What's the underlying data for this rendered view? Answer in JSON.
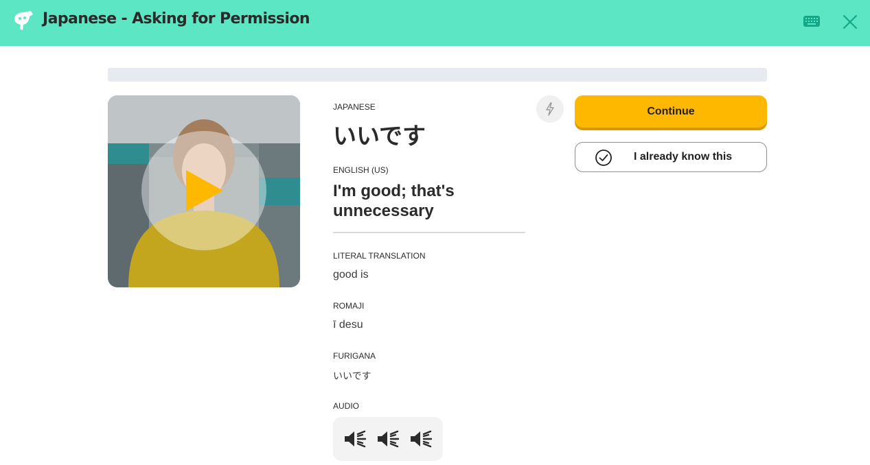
{
  "header": {
    "title": "Japanese - Asking for Permission",
    "logo_icon": "mascot-logo-icon",
    "keyboard_icon": "keyboard-icon",
    "close_icon": "close-icon",
    "background_color": "#5ce6c4"
  },
  "progress": {
    "fraction": 0.0
  },
  "video": {
    "play_icon": "play-icon"
  },
  "card": {
    "japanese_label": "JAPANESE",
    "japanese_word": "いいです",
    "english_label": "ENGLISH (US)",
    "english_text": "I'm good; that's unnecessary",
    "literal_label": "LITERAL TRANSLATION",
    "literal_value": "good is",
    "romaji_label": "ROMAJI",
    "romaji_value": "ī desu",
    "furigana_label": "FURIGANA",
    "furigana_value": "いいです",
    "audio_label": "AUDIO",
    "audio_icons": [
      "speaker-icon",
      "speaker-icon",
      "speaker-icon"
    ]
  },
  "actions": {
    "bolt_icon": "lightning-icon",
    "continue_label": "Continue",
    "already_know_label": "I already know this",
    "check_icon": "check-circle-icon",
    "accent_color": "#ffb800"
  }
}
